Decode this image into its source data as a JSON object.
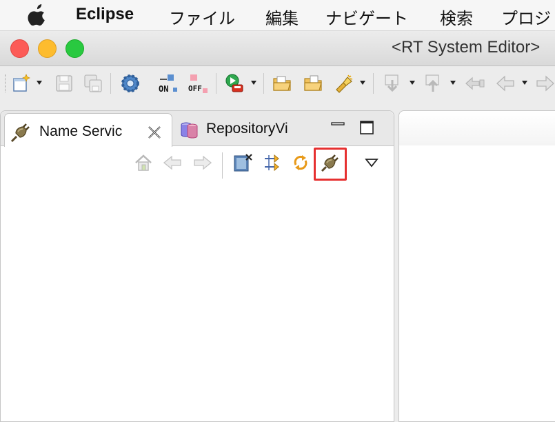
{
  "menubar": {
    "app_name": "Eclipse",
    "items": [
      "ファイル",
      "編集",
      "ナビゲート",
      "検索",
      "プロジ"
    ]
  },
  "window": {
    "title": "<RT System Editor>"
  },
  "toolbar": {
    "icons": [
      "new-wizard-icon",
      "save-icon",
      "save-all-icon",
      "settings-gear-icon",
      "all-on-icon",
      "all-off-icon",
      "run-icon",
      "open-folder-icon",
      "open-folder-alt-icon",
      "search-flashlight-icon",
      "next-annotation-icon",
      "prev-annotation-icon",
      "last-edit-icon",
      "back-icon",
      "forward-icon"
    ]
  },
  "view": {
    "tabs": [
      {
        "label": "Name Servic",
        "icon": "plug-icon",
        "active": true
      },
      {
        "label": "RepositoryVi",
        "icon": "repository-icon",
        "active": false
      }
    ],
    "toolbar_icons": [
      "home-icon",
      "back-arrow-icon",
      "forward-arrow-icon",
      "clear-zombie-icon",
      "filter-icon",
      "refresh-icon",
      "connect-name-server-icon",
      "view-menu-icon"
    ],
    "highlighted_tool": "connect-name-server-icon"
  },
  "colors": {
    "highlight": "#e63030",
    "traffic_red": "#fc5b57",
    "traffic_yellow": "#fdbc2e",
    "traffic_green": "#29c940"
  }
}
